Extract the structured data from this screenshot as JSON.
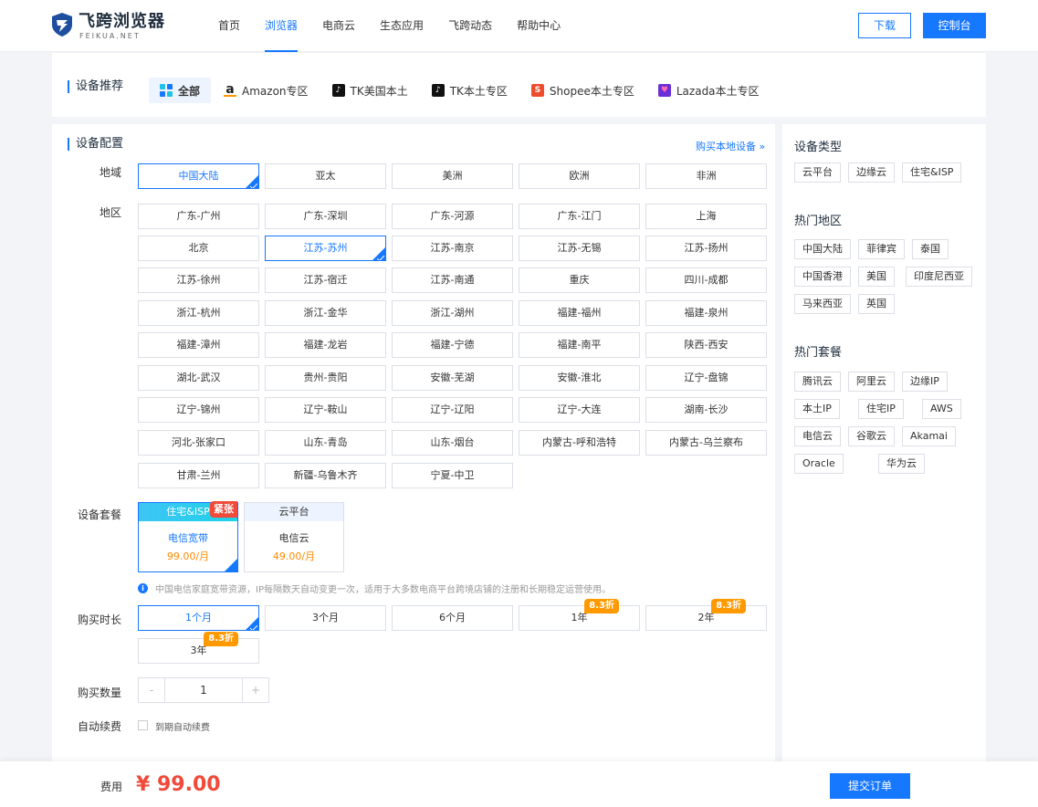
{
  "brand": {
    "name": "飞跨浏览器",
    "sub": "FEIKUA.NET"
  },
  "nav": [
    {
      "label": "首页"
    },
    {
      "label": "浏览器",
      "active": true
    },
    {
      "label": "电商云"
    },
    {
      "label": "生态应用"
    },
    {
      "label": "飞跨动态"
    },
    {
      "label": "帮助中心"
    }
  ],
  "header": {
    "download": "下载",
    "console": "控制台"
  },
  "recommend": {
    "title": "设备推荐",
    "tabs": [
      {
        "label": "全部",
        "icon": "grid-icon",
        "active": true
      },
      {
        "label": "Amazon专区",
        "icon": "amazon-icon"
      },
      {
        "label": "TK美国本土",
        "icon": "tiktok-icon"
      },
      {
        "label": "TK本土专区",
        "icon": "tiktok-icon"
      },
      {
        "label": "Shopee本土专区",
        "icon": "shopee-icon"
      },
      {
        "label": "Lazada本土专区",
        "icon": "lazada-icon"
      }
    ]
  },
  "config": {
    "title": "设备配置",
    "buy_local": "购买本地设备 »",
    "region_label": "地域",
    "regions": [
      "中国大陆",
      "亚太",
      "美洲",
      "欧洲",
      "非洲"
    ],
    "region_selected": 0,
    "area_label": "地区",
    "areas": [
      "广东-广州",
      "广东-深圳",
      "广东-河源",
      "广东-江门",
      "上海",
      "北京",
      "江苏-苏州",
      "江苏-南京",
      "江苏-无锡",
      "江苏-扬州",
      "江苏-徐州",
      "江苏-宿迁",
      "江苏-南通",
      "重庆",
      "四川-成都",
      "浙江-杭州",
      "浙江-金华",
      "浙江-湖州",
      "福建-福州",
      "福建-泉州",
      "福建-漳州",
      "福建-龙岩",
      "福建-宁德",
      "福建-南平",
      "陕西-西安",
      "湖北-武汉",
      "贵州-贵阳",
      "安徽-芜湖",
      "安徽-淮北",
      "辽宁-盘锦",
      "辽宁-锦州",
      "辽宁-鞍山",
      "辽宁-辽阳",
      "辽宁-大连",
      "湖南-长沙",
      "河北-张家口",
      "山东-青岛",
      "山东-烟台",
      "内蒙古-呼和浩特",
      "内蒙古-乌兰察布",
      "甘肃-兰州",
      "新疆-乌鲁木齐",
      "宁夏-中卫"
    ],
    "area_selected": 6,
    "plan_label": "设备套餐",
    "plans": [
      {
        "head": "住宅&ISP",
        "name": "电信宽带",
        "price": "99.00/月",
        "badge": "紧张",
        "selected": true
      },
      {
        "head": "云平台",
        "name": "电信云",
        "price": "49.00/月",
        "badge": "",
        "selected": false
      }
    ],
    "notice": "中国电信家庭宽带资源，IP每隔数天自动变更一次，适用于大多数电商平台跨境店铺的注册和长期稳定运营使用。",
    "duration_label": "购买时长",
    "durations": [
      {
        "label": "1个月",
        "discount": ""
      },
      {
        "label": "3个月",
        "discount": ""
      },
      {
        "label": "6个月",
        "discount": ""
      },
      {
        "label": "1年",
        "discount": "8.3折"
      },
      {
        "label": "2年",
        "discount": "8.3折"
      },
      {
        "label": "3年",
        "discount": "8.3折"
      }
    ],
    "duration_selected": 0,
    "qty_label": "购买数量",
    "qty_minus": "-",
    "qty_plus": "+",
    "qty_value": "1",
    "auto_label": "自动续费",
    "auto_text": "到期自动续费"
  },
  "side": {
    "type_title": "设备类型",
    "types": [
      "云平台",
      "边缘云",
      "住宅&ISP"
    ],
    "hot_region_title": "热门地区",
    "hot_regions": [
      "中国大陆",
      "菲律宾",
      "泰国",
      "中国香港",
      "美国",
      "印度尼西亚",
      "马来西亚",
      "英国"
    ],
    "hot_plan_title": "热门套餐",
    "hot_plans": [
      "腾讯云",
      "阿里云",
      "边缘IP",
      "本土IP",
      "住宅IP",
      "AWS",
      "电信云",
      "谷歌云",
      "Akamai",
      "Oracle",
      "华为云"
    ]
  },
  "footer": {
    "fee_label": "费用",
    "fee_value": "¥ 99.00",
    "submit": "提交订单"
  },
  "colors": {
    "accent": "#1677ff",
    "price": "#f04a3a",
    "discount": "#ff9900"
  }
}
